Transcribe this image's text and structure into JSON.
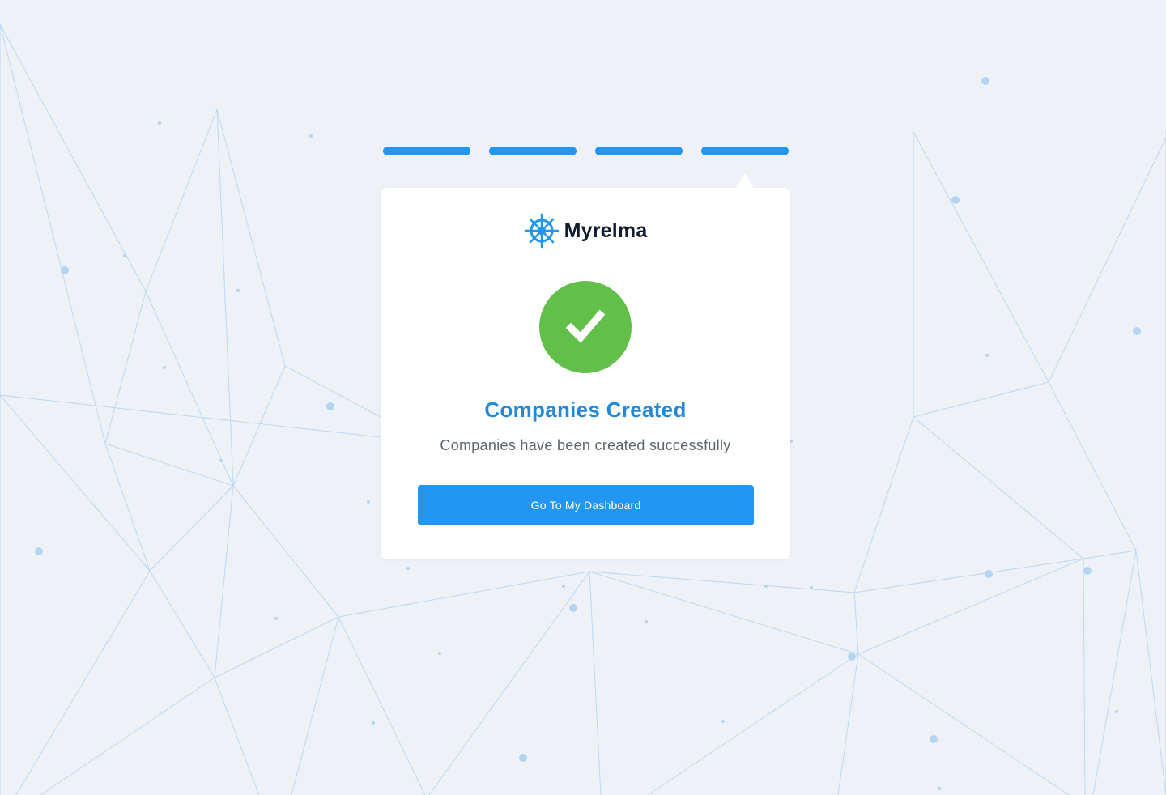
{
  "brand": {
    "name": "Myrelma",
    "icon": "ship-wheel-icon",
    "color": "#2196f3"
  },
  "progress": {
    "total_steps": 4,
    "completed_steps": 4,
    "active_step": 4,
    "color": "#2196f3"
  },
  "status": {
    "icon": "checkmark-icon",
    "color": "#62c04a",
    "title": "Companies Created",
    "message": "Companies have been created successfully"
  },
  "actions": {
    "dashboard_label": "Go To My Dashboard",
    "color": "#2196f3"
  }
}
